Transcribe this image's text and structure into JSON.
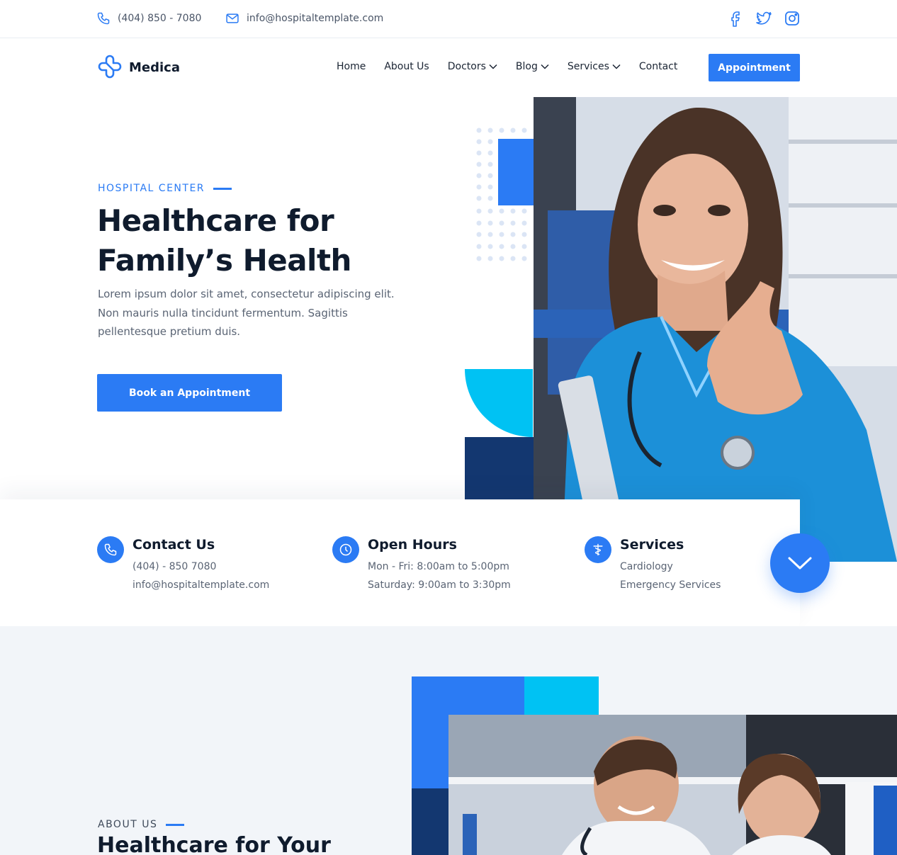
{
  "topbar": {
    "phone": "(404) 850 - 7080",
    "email": "info@hospitaltemplate.com",
    "socials": [
      "facebook-icon",
      "twitter-icon",
      "instagram-icon"
    ]
  },
  "brand": {
    "name": "Medica"
  },
  "nav": {
    "home": "Home",
    "about": "About Us",
    "doctors": "Doctors",
    "blog": "Blog",
    "services": "Services",
    "contact": "Contact",
    "cta": "Appointment"
  },
  "hero": {
    "eyebrow": "HOSPITAL CENTER",
    "title_line1": "Healthcare for",
    "title_line2": "Family’s Health",
    "text": "Lorem ipsum dolor sit amet, consectetur adipiscing elit. Non mauris nulla tincidunt fermentum. Sagittis pellentesque pretium duis.",
    "button": "Book an Appointment"
  },
  "info": {
    "contact": {
      "title": "Contact Us",
      "line1": "(404) - 850  7080",
      "line2": "info@hospitaltemplate.com"
    },
    "hours": {
      "title": "Open Hours",
      "line1": "Mon - Fri: 8:00am to 5:00pm",
      "line2": "Saturday: 9:00am to 3:30pm"
    },
    "services": {
      "title": "Services",
      "line1": "Cardiology",
      "line2": "Emergency Services"
    }
  },
  "about": {
    "eyebrow": "ABOUT US",
    "title": "Healthcare for Your"
  },
  "colors": {
    "primary": "#2b7bf4",
    "cyan": "#00c2f3",
    "navy": "#133770",
    "dark_text": "#0f1b2d",
    "section_bg": "#f2f5f9"
  }
}
